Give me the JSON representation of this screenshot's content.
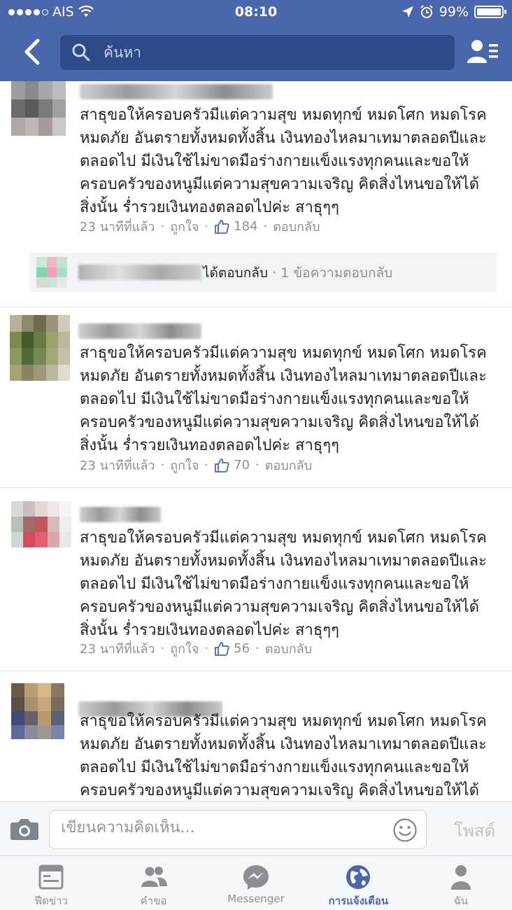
{
  "status_bar": {
    "carrier": "AIS",
    "time": "08:10",
    "battery": "99%"
  },
  "header": {
    "search_placeholder": "ค้นหา",
    "back_icon": "chevron-left-icon",
    "friends_icon": "friend-list-icon"
  },
  "comments": [
    {
      "text": "สาธุขอให้ครอบครัวมีแต่ความสุข หมดทุกข์ หมดโศก หมดโรค หมดภัย อันตรายทั้งหมดทั้งสิ้น  เงินทองไหลมาเทมาตลอดปีและตลอดไป มีเงินใช้ไม่ขาดมือร่างกายแข็งแรงทุกคนและขอให้ครอบครัวของหนูมีแต่ความสุขความเจริญ คิดสิ่งไหนขอให้ได้สิ่งนั้น  ร่ำรวยเงินทองตลอดไปค่ะ สาธุๆๆ",
      "time": "23 นาทีที่แล้ว",
      "like": "ถูกใจ",
      "likes": "184",
      "reply": "ตอบกลับ"
    },
    {
      "text": "สาธุขอให้ครอบครัวมีแต่ความสุข หมดทุกข์ หมดโศก หมดโรค หมดภัย อันตรายทั้งหมดทั้งสิ้น  เงินทองไหลมาเทมาตลอดปีและตลอดไป มีเงินใช้ไม่ขาดมือร่างกายแข็งแรงทุกคนและขอให้ครอบครัวของหนูมีแต่ความสุขความเจริญ คิดสิ่งไหนขอให้ได้สิ่งนั้น  ร่ำรวยเงินทองตลอดไปค่ะ สาธุๆๆ",
      "time": "23 นาทีที่แล้ว",
      "like": "ถูกใจ",
      "likes": "70",
      "reply": "ตอบกลับ"
    },
    {
      "text": "สาธุขอให้ครอบครัวมีแต่ความสุข หมดทุกข์ หมดโศก หมดโรค หมดภัย อันตรายทั้งหมดทั้งสิ้น  เงินทองไหลมาเทมาตลอดปีและตลอดไป มีเงินใช้ไม่ขาดมือร่างกายแข็งแรงทุกคนและขอให้ครอบครัวของหนูมีแต่ความสุขความเจริญ คิดสิ่งไหนขอให้ได้สิ่งนั้น  ร่ำรวยเงินทองตลอดไปค่ะ สาธุๆๆ",
      "time": "23 นาทีที่แล้ว",
      "like": "ถูกใจ",
      "likes": "56",
      "reply": "ตอบกลับ"
    },
    {
      "text": "สาธุขอให้ครอบครัวมีแต่ความสุข หมดทุกข์ หมดโศก หมดโรค หมดภัย อันตรายทั้งหมดทั้งสิ้น  เงินทองไหลมาเทมาตลอดปีและตลอดไป มีเงินใช้ไม่ขาดมือร่างกายแข็งแรงทุกคนและขอให้ครอบครัวของหนูมีแต่ความสุขความเจริญ คิดสิ่งไหนขอให้ได้สิ่งนั้น  ร่ำรวยเงินทองตลอดไปค่ะ สาธุๆๆ"
    }
  ],
  "reply_summary": {
    "action": "ได้ตอบกลับ",
    "count": "1 ข้อความตอบกลับ"
  },
  "composer": {
    "placeholder": "เขียนความคิดเห็น...",
    "post_label": "โพสต์"
  },
  "tabs": [
    {
      "label": "ฟีดข่าว",
      "icon": "news-feed-icon"
    },
    {
      "label": "คำขอ",
      "icon": "friend-requests-icon"
    },
    {
      "label": "Messenger",
      "icon": "messenger-icon"
    },
    {
      "label": "การแจ้งเตือน",
      "icon": "notifications-globe-icon",
      "active": true
    },
    {
      "label": "ฉัน",
      "icon": "profile-icon"
    }
  ],
  "colors": {
    "brand": "#4a67ad",
    "header_search_bg": "#2f4a89",
    "meta_text": "#8b8f95"
  }
}
